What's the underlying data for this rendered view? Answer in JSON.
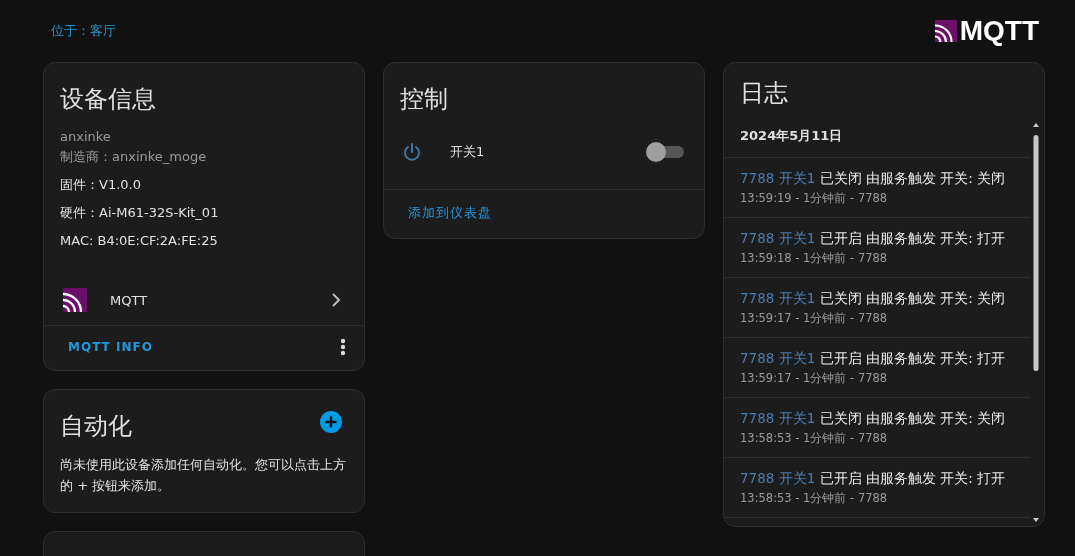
{
  "header": {
    "location": "位于：客厅",
    "logo_text": "MQTT"
  },
  "device_info": {
    "title": "设备信息",
    "model": "anxinke",
    "manufacturer": "制造商：anxinke_moge",
    "firmware": "固件：V1.0.0",
    "hardware": "硬件：Ai-M61-32S-Kit_01",
    "mac": "MAC: B4:0E:CF:2A:FE:25",
    "integration": "MQTT",
    "action": "MQTT INFO"
  },
  "automation": {
    "title": "自动化",
    "message": "尚未使用此设备添加任何自动化。您可以点击上方的 + 按钮来添加。"
  },
  "controls": {
    "title": "控制",
    "entities": [
      {
        "name": "开关1",
        "on": false
      }
    ],
    "action": "添加到仪表盘"
  },
  "logbook": {
    "title": "日志",
    "date": "2024年5月11日",
    "entries": [
      {
        "entity": "7788 开关1",
        "message": "已关闭 由服务触发 开关: 关闭",
        "meta": "13:59:19 - 1分钟前 - 7788"
      },
      {
        "entity": "7788 开关1",
        "message": "已开启 由服务触发 开关: 打开",
        "meta": "13:59:18 - 1分钟前 - 7788"
      },
      {
        "entity": "7788 开关1",
        "message": "已关闭 由服务触发 开关: 关闭",
        "meta": "13:59:17 - 1分钟前 - 7788"
      },
      {
        "entity": "7788 开关1",
        "message": "已开启 由服务触发 开关: 打开",
        "meta": "13:59:17 - 1分钟前 - 7788"
      },
      {
        "entity": "7788 开关1",
        "message": "已关闭 由服务触发 开关: 关闭",
        "meta": "13:58:53 - 1分钟前 - 7788"
      },
      {
        "entity": "7788 开关1",
        "message": "已开启 由服务触发 开关: 打开",
        "meta": "13:58:53 - 1分钟前 - 7788"
      }
    ]
  }
}
